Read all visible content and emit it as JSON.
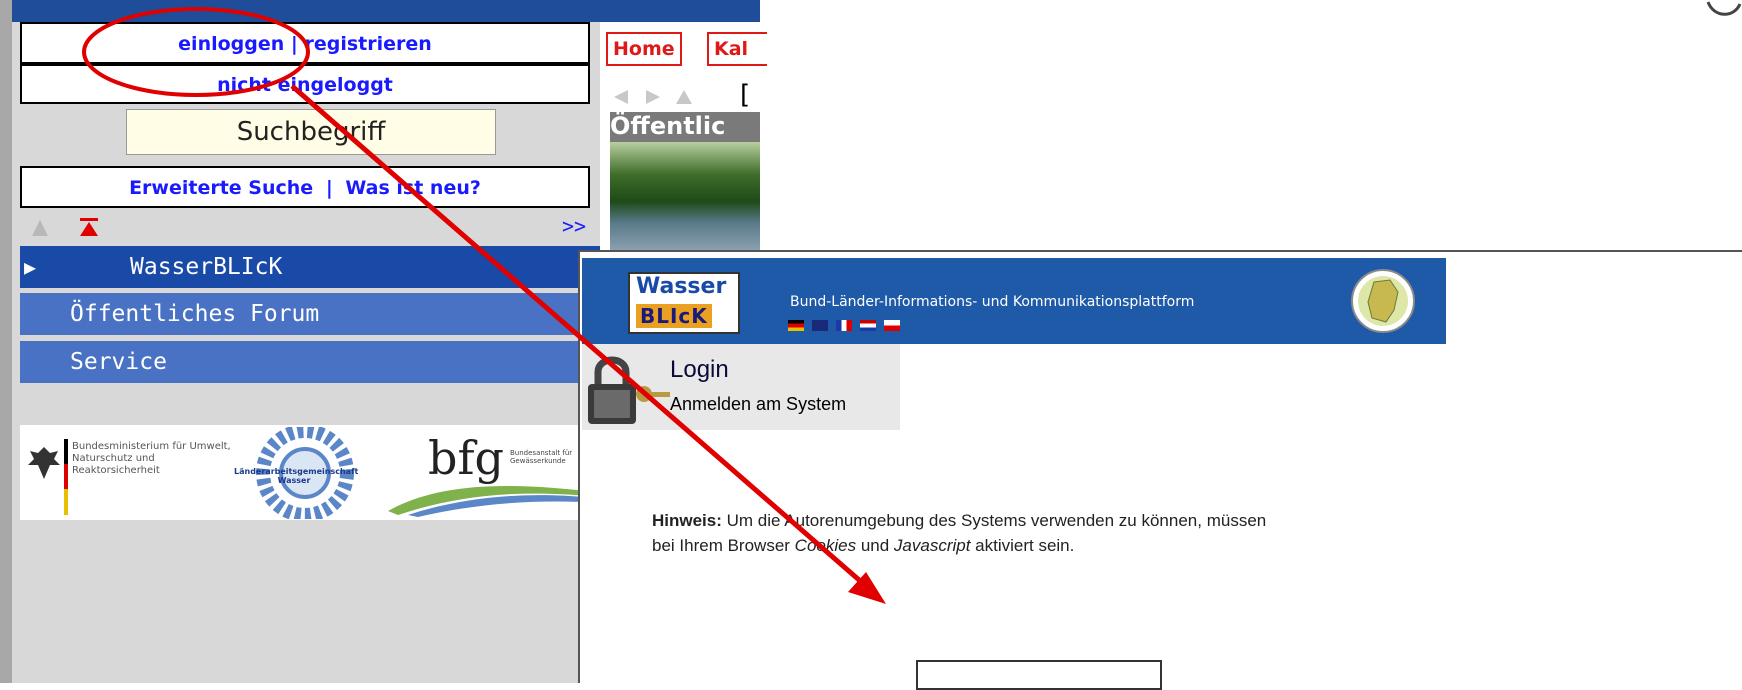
{
  "left": {
    "login_link": "einloggen",
    "separator": "|",
    "register_link": "registrieren",
    "status": "nicht eingeloggt",
    "search_placeholder": "Suchbegriff",
    "advanced_search": "Erweiterte Suche",
    "separator2": "|",
    "whats_new": "Was ist neu?",
    "expand_label": ">>",
    "menu": [
      {
        "label": "WasserBLIcK",
        "active": true
      },
      {
        "label": "Öffentliches Forum",
        "active": false
      },
      {
        "label": "Service",
        "active": false
      }
    ],
    "logos": {
      "ministry_text": "Bundesministerium für Umwelt, Naturschutz und Reaktorsicherheit",
      "lawa_text": "Länderarbeitsgemeinschaft Wasser",
      "bfg_text": "bfg",
      "bfg_sub": "Bundesanstalt für Gewässerkunde"
    }
  },
  "mid": {
    "tabs": [
      "Home",
      "Kal"
    ],
    "bracket": "[",
    "heading": "Öffentlic"
  },
  "popup": {
    "logo_top": "Wasser",
    "logo_bottom": "BLIcK",
    "banner_title": "Bund-Länder-Informations- und Kommunikationsplattform",
    "login_title": "Login",
    "login_subtitle": "Anmelden am System",
    "hint_label": "Hinweis:",
    "hint_part1": "Um die Autorenumgebung des Systems verwenden zu können, müssen bei Ihrem Browser ",
    "hint_cookies": "Cookies",
    "hint_and": " und ",
    "hint_js": "Javascript",
    "hint_end": " aktiviert sein."
  },
  "colors": {
    "nav_blue": "#1f4d9a",
    "menu_active": "#1a4aa8",
    "menu_item": "#4a72c4",
    "link_blue": "#1a1aff",
    "annotation_red": "#e00000",
    "tab_red": "#e01818"
  }
}
